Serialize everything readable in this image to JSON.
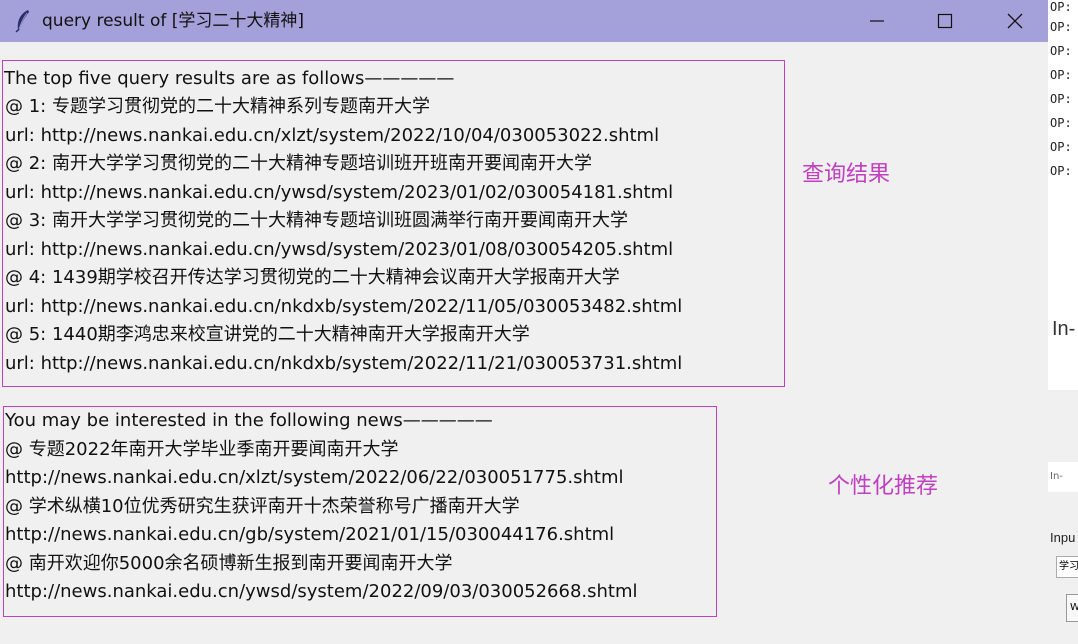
{
  "window": {
    "title": "query result of [学习二十大精神]"
  },
  "results_panel": {
    "header": "The top five query results are as follows—————",
    "items": [
      {
        "title": " @ 1: 专题学习贯彻党的二十大精神系列专题南开大学",
        "url": " url: http://news.nankai.edu.cn/xlzt/system/2022/10/04/030053022.shtml"
      },
      {
        "title": " @ 2: 南开大学学习贯彻党的二十大精神专题培训班开班南开要闻南开大学",
        "url": " url: http://news.nankai.edu.cn/ywsd/system/2023/01/02/030054181.shtml"
      },
      {
        "title": " @ 3: 南开大学学习贯彻党的二十大精神专题培训班圆满举行南开要闻南开大学",
        "url": " url: http://news.nankai.edu.cn/ywsd/system/2023/01/08/030054205.shtml"
      },
      {
        "title": " @ 4: 1439期学校召开传达学习贯彻党的二十大精神会议南开大学报南开大学",
        "url": " url: http://news.nankai.edu.cn/nkdxb/system/2022/11/05/030053482.shtml"
      },
      {
        "title": " @ 5: 1440期李鸿忠来校宣讲党的二十大精神南开大学报南开大学",
        "url": " url: http://news.nankai.edu.cn/nkdxb/system/2022/11/21/030053731.shtml"
      }
    ]
  },
  "recommend_panel": {
    "header": "You may be interested in the following news—————",
    "items": [
      {
        "title": "@ 专题2022年南开大学毕业季南开要闻南开大学",
        "url": " http://news.nankai.edu.cn/xlzt/system/2022/06/22/030051775.shtml"
      },
      {
        "title": "@ 学术纵横10位优秀研究生获评南开十杰荣誉称号广播南开大学",
        "url": " http://news.nankai.edu.cn/gb/system/2021/01/15/030044176.shtml"
      },
      {
        "title": "@ 南开欢迎你5000余名硕博新生报到南开要闻南开大学",
        "url": " http://news.nankai.edu.cn/ywsd/system/2022/09/03/030052668.shtml"
      }
    ]
  },
  "annotations": {
    "results_label": "查询结果",
    "recommend_label": "个性化推荐"
  },
  "background": {
    "console_lines": [
      "OP:",
      "OP:",
      "OP:",
      "OP:",
      "OP:",
      "OP:",
      "OP:",
      "OP:"
    ],
    "side_text": "In-",
    "mini_window_title": "In-",
    "mini_label": "Inpu",
    "mini_entry_value": "学习",
    "mini_button_label": "W"
  },
  "colors": {
    "titlebar": "#a4a0d9",
    "window_bg": "#f0f0f0",
    "annotation": "#c040c0"
  }
}
